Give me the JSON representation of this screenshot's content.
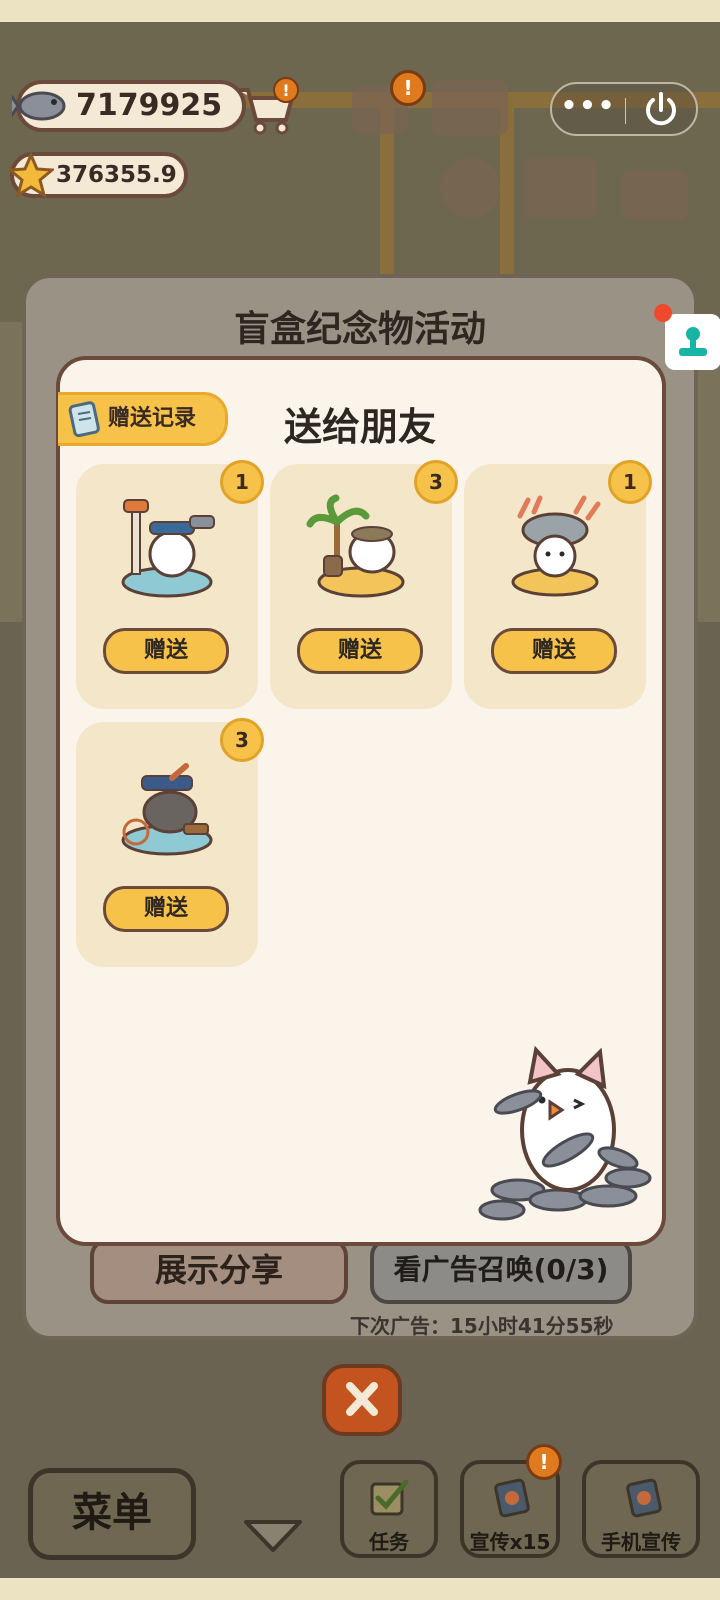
{
  "currency": {
    "fish": "7179925",
    "stars": "376355.9"
  },
  "capsule": {
    "more": "•••"
  },
  "dialog": {
    "title": "盲盒纪念物活动",
    "panel_title": "送给朋友",
    "record_tab": "赠送记录",
    "items": [
      {
        "count": "1",
        "button": "赠送",
        "icon": "sailor-cat-souvenir-icon"
      },
      {
        "count": "3",
        "button": "赠送",
        "icon": "island-palm-cat-souvenir-icon"
      },
      {
        "count": "1",
        "button": "赠送",
        "icon": "coral-fish-hat-cat-souvenir-icon"
      },
      {
        "count": "3",
        "button": "赠送",
        "icon": "pirate-cat-souvenir-icon"
      }
    ],
    "share_button": "展示分享",
    "ad_button": "看广告召唤(0/3)",
    "next_ad": "下次广告：15小时41分55秒"
  },
  "bottom_bar": {
    "menu": "菜单",
    "tasks": "任务",
    "promote": "宣传x15",
    "phone_promote": "手机宣传"
  },
  "colors": {
    "panel_bg": "#faf4ea",
    "card_bg": "#f4e6c8",
    "accent_yellow": "#f6c24a",
    "border_brown": "#6b4a3c",
    "close_orange": "#c4541f"
  }
}
